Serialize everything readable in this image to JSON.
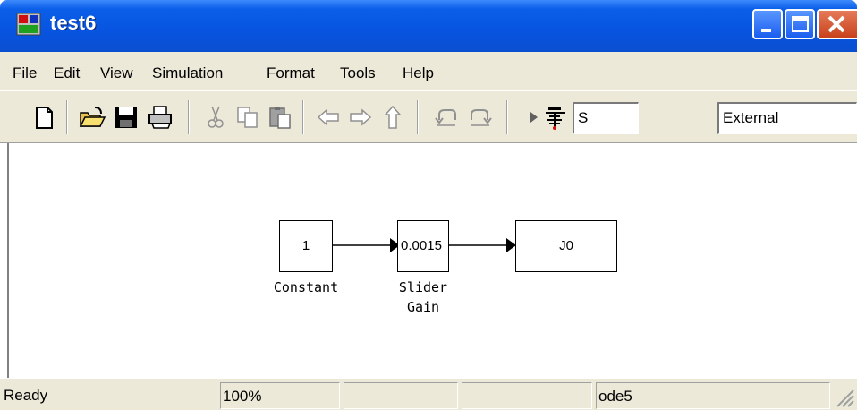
{
  "window": {
    "title": "test6",
    "icons": {
      "app": "simulink-model-icon",
      "minimize": "minimize-icon",
      "maximize": "maximize-icon",
      "close": "close-icon"
    }
  },
  "menu": [
    "File",
    "Edit",
    "View",
    "Simulation",
    "Format",
    "Tools",
    "Help"
  ],
  "toolbar": {
    "buttons": [
      "new-icon",
      "open-icon",
      "save-icon",
      "print-icon",
      "cut-icon",
      "copy-icon",
      "paste-icon",
      "back-icon",
      "forward-icon",
      "up-icon",
      "undo-icon",
      "redo-icon",
      "start-simulation-icon",
      "build-icon"
    ],
    "stop_time": "S",
    "sim_mode": "External"
  },
  "diagram": {
    "blocks": [
      {
        "name": "constant",
        "display": "1",
        "label": "Constant"
      },
      {
        "name": "slider-gain",
        "display": "0.0015",
        "label_line1": "Slider",
        "label_line2": "Gain"
      },
      {
        "name": "j0",
        "display": "J0"
      }
    ]
  },
  "status": {
    "text": "Ready",
    "zoom": "100%",
    "cell3": "",
    "cell4": "",
    "solver": "ode5"
  }
}
